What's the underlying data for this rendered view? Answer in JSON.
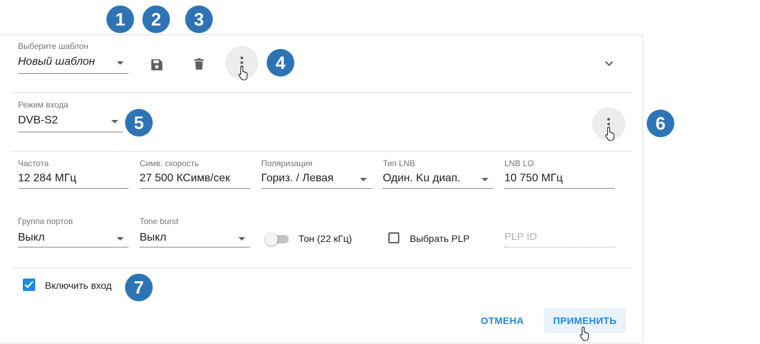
{
  "template": {
    "label": "Выберите шаблон",
    "value": "Новый шаблон"
  },
  "input_mode": {
    "label": "Режим входа",
    "value": "DVB-S2"
  },
  "fields": {
    "frequency": {
      "label": "Частота",
      "value": "12 284 МГц"
    },
    "symbol_rate": {
      "label": "Симв. скорость",
      "value": "27 500 КСимв/сек"
    },
    "polarization": {
      "label": "Поляризация",
      "value": "Гориз. / Левая"
    },
    "lnb_type": {
      "label": "Тип LNB",
      "value": "Один. Ku диап."
    },
    "lnb_lo": {
      "label": "LNB LO",
      "value": "10 750 МГц"
    },
    "port_group": {
      "label": "Группа портов",
      "value": "Выкл"
    },
    "tone_burst": {
      "label": "Tone burst",
      "value": "Выкл"
    },
    "tone": {
      "label": "Тон (22 кГц)",
      "on": false
    },
    "select_plp": {
      "label": "Выбрать PLP",
      "checked": false
    },
    "plp_id": {
      "placeholder": "PLP ID"
    }
  },
  "enable_input": {
    "label": "Включить вход",
    "checked": true
  },
  "actions": {
    "cancel": "ОТМЕНА",
    "apply": "ПРИМЕНИТЬ"
  },
  "badges": [
    "1",
    "2",
    "3",
    "4",
    "5",
    "6",
    "7"
  ],
  "colors": {
    "accent": "#1e88e5",
    "badge": "#2e74b5",
    "checkbox": "#1e88e5"
  },
  "icons": [
    "save-icon",
    "delete-icon",
    "more-vert-icon",
    "chevron-down-icon",
    "pointer-hand-icon"
  ]
}
